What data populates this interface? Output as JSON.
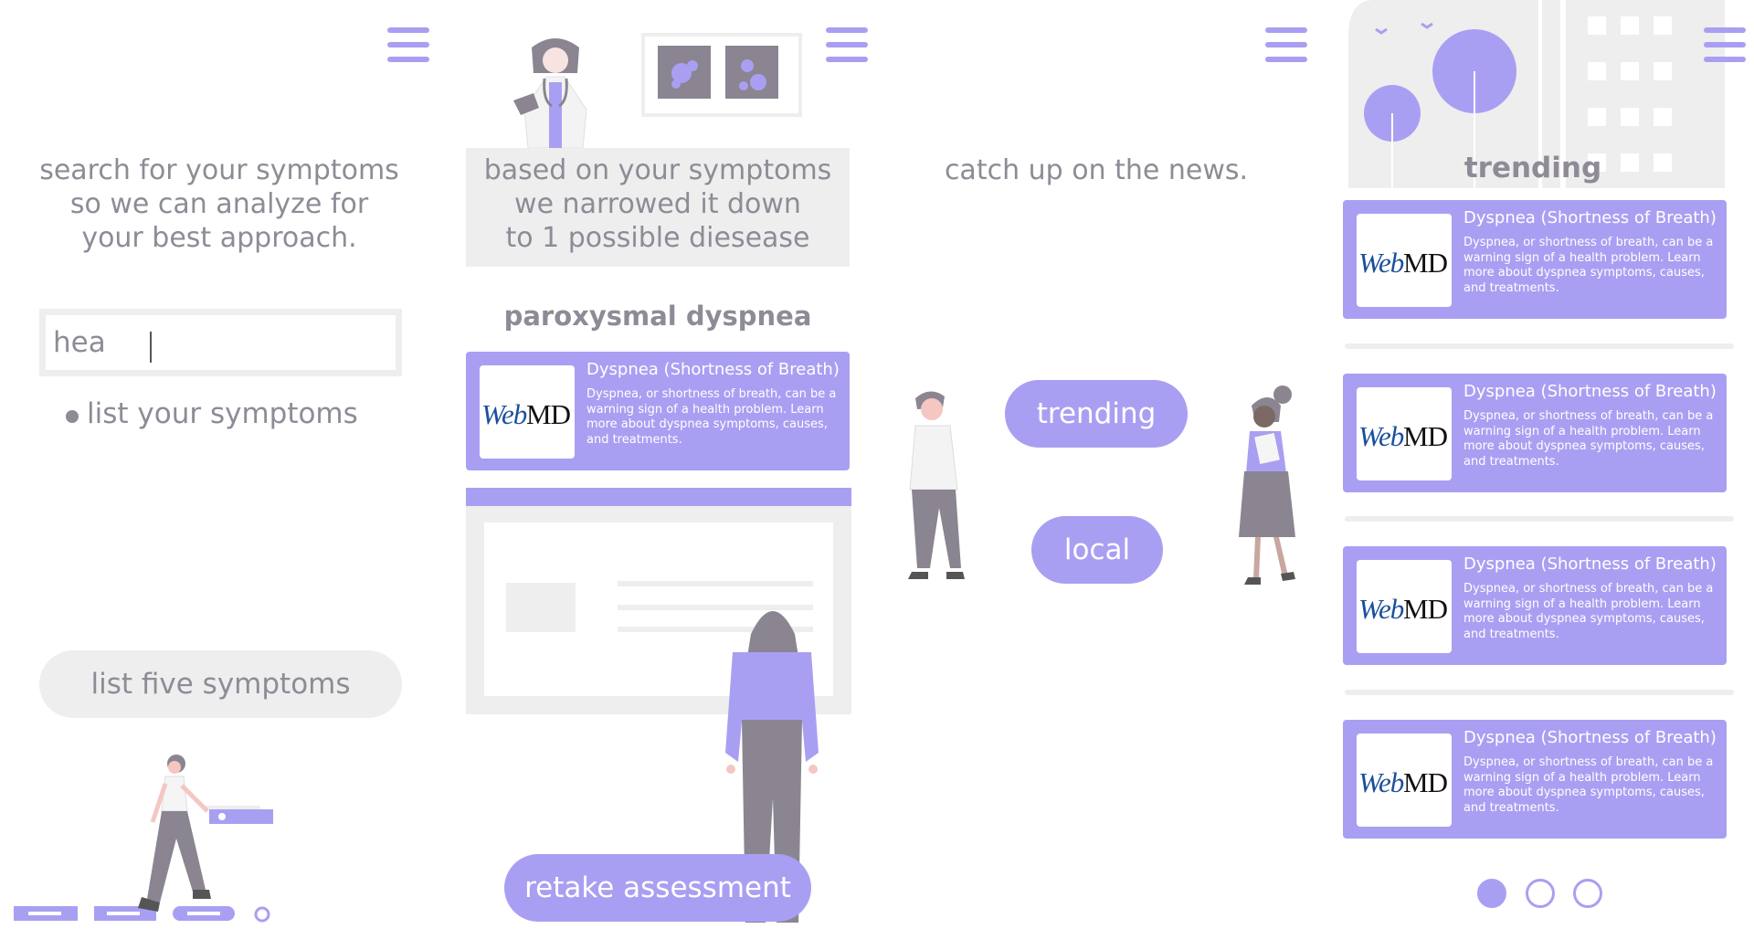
{
  "panel1": {
    "heading_lines": [
      "search for your symptoms",
      "so we can analyze for",
      "your best approach."
    ],
    "search": {
      "value": "hea",
      "placeholder": ""
    },
    "bullet_item": "list your symptoms",
    "button_label": "list five symptoms"
  },
  "panel2": {
    "heading_lines": [
      "based on your symptoms",
      "we narrowed it down",
      "to 1 possible diesease"
    ],
    "disease_name": "paroxysmal dyspnea",
    "card": {
      "logo_web": "Web",
      "logo_md": "MD",
      "title": "Dyspnea (Shortness of Breath)",
      "description": "Dyspnea, or shortness of breath, can be a warning sign of a health problem. Learn more about dyspnea symptoms, causes, and treatments."
    },
    "button_label": "retake assessment"
  },
  "panel3": {
    "heading": "catch up on the news.",
    "buttons": [
      "trending",
      "local"
    ]
  },
  "panel4": {
    "heading": "trending",
    "cards": [
      {
        "logo_web": "Web",
        "logo_md": "MD",
        "title": "Dyspnea (Shortness of Breath)",
        "description": "Dyspnea, or shortness of breath, can be a warning sign of a health problem. Learn more about dyspnea symptoms, causes, and treatments."
      },
      {
        "logo_web": "Web",
        "logo_md": "MD",
        "title": "Dyspnea (Shortness of Breath)",
        "description": "Dyspnea, or shortness of breath, can be a warning sign of a health problem. Learn more about dyspnea symptoms, causes, and treatments."
      },
      {
        "logo_web": "Web",
        "logo_md": "MD",
        "title": "Dyspnea (Shortness of Breath)",
        "description": "Dyspnea, or shortness of breath, can be a warning sign of a health problem. Learn more about dyspnea symptoms, causes, and treatments."
      },
      {
        "logo_web": "Web",
        "logo_md": "MD",
        "title": "Dyspnea (Shortness of Breath)",
        "description": "Dyspnea, or shortness of breath, can be a warning sign of a health problem. Learn more about dyspnea symptoms, causes, and treatments."
      }
    ],
    "pagination": {
      "pages": 3,
      "current": 1
    }
  },
  "colors": {
    "accent": "#a99ff2",
    "text": "#8f8b96",
    "muted_bg": "#eeeeee",
    "illustration_grey": "#8a8590",
    "logo_blue": "#1a4f9c"
  },
  "icons": [
    "menu-icon",
    "doctor-illustration",
    "xray-illustration",
    "walking-woman-illustration",
    "standing-woman-illustration",
    "man-illustration",
    "woman-reading-illustration",
    "city-illustration"
  ]
}
